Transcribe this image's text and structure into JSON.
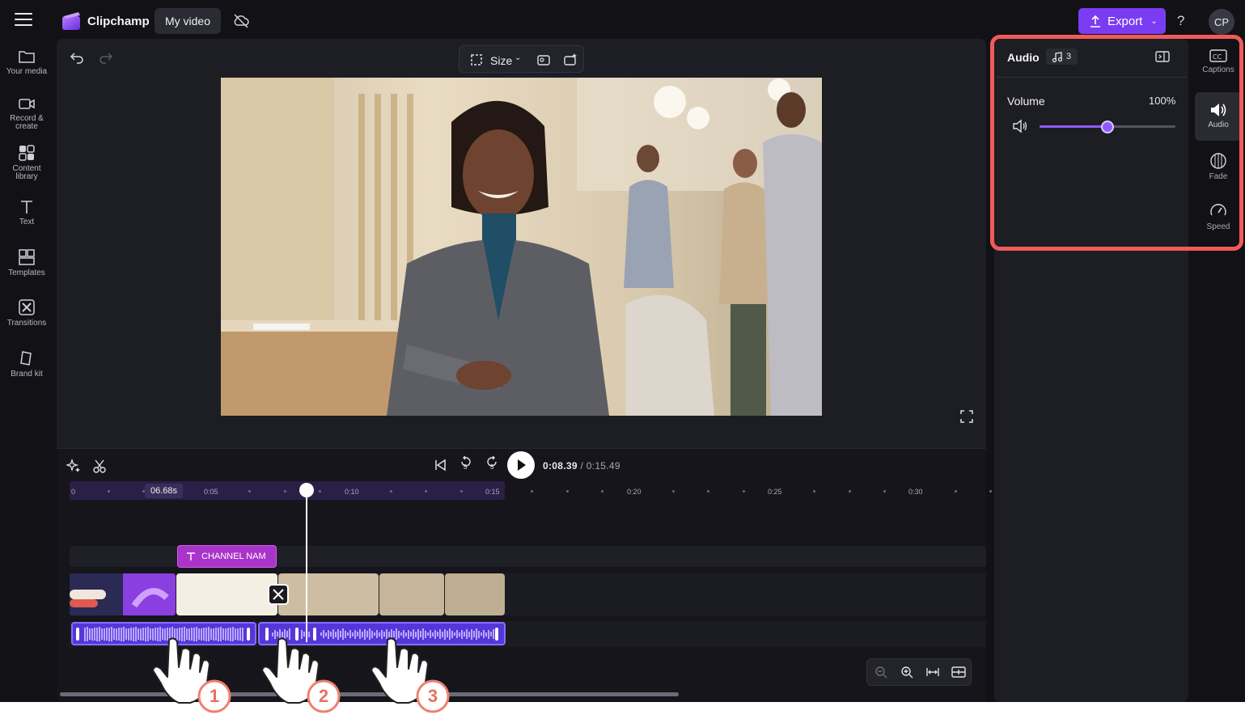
{
  "app": {
    "name": "Clipchamp",
    "project_title": "My video",
    "export_label": "Export",
    "help_label": "?",
    "avatar_initials": "CP",
    "accent_color": "#7a3cf2"
  },
  "left_nav": [
    {
      "label": "Your media",
      "icon": "folder-icon"
    },
    {
      "label": "Record & create",
      "icon": "camera-icon"
    },
    {
      "label": "Content library",
      "icon": "library-icon"
    },
    {
      "label": "Text",
      "icon": "text-icon"
    },
    {
      "label": "Templates",
      "icon": "templates-icon"
    },
    {
      "label": "Transitions",
      "icon": "transitions-icon"
    },
    {
      "label": "Brand kit",
      "icon": "brand-kit-icon"
    }
  ],
  "preview": {
    "size_label": "Size"
  },
  "playback": {
    "current_time": "0:08.39",
    "duration": "/ 0:15.49",
    "skip_back_label": "5",
    "skip_forward_label": "5"
  },
  "timeline": {
    "time_badge": "06.68s",
    "ruler_labels": [
      "0",
      "0:05",
      "0:10",
      "0:15",
      "0:20",
      "0:25",
      "0:30"
    ],
    "text_clip_label": "CHANNEL NAM"
  },
  "property_panel": {
    "title": "Audio",
    "badge_count": "3",
    "volume_label": "Volume",
    "volume_value": "100%",
    "volume_level": 0.5
  },
  "right_tabs": [
    {
      "label": "Captions",
      "icon": "captions-icon"
    },
    {
      "label": "Audio",
      "icon": "speaker-icon",
      "active": true
    },
    {
      "label": "Fade",
      "icon": "fade-icon"
    },
    {
      "label": "Speed",
      "icon": "speed-icon"
    }
  ],
  "annotations": {
    "steps": [
      "1",
      "2",
      "3"
    ],
    "highlight_color": "#f05a5a"
  }
}
